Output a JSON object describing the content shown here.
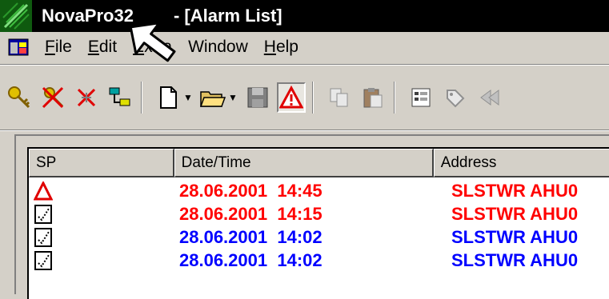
{
  "window": {
    "app_name": "NovaPro32",
    "doc_title": "- [Alarm List]",
    "app_icon": "novapro-leaf-icon"
  },
  "menu": {
    "icon": "mdi-child-window-icon",
    "items": [
      {
        "first": "F",
        "rest": "ile"
      },
      {
        "first": "E",
        "rest": "dit"
      },
      {
        "first": "E",
        "rest": "xtra"
      },
      {
        "first": "",
        "rest": "Window"
      },
      {
        "first": "H",
        "rest": "elp"
      }
    ]
  },
  "toolbar": {
    "buttons": [
      "key-icon",
      "key-cross-icon",
      "disconnect-icon",
      "network-icon",
      "new-document-icon",
      "open-folder-icon",
      "save-disk-icon",
      "alarm-warning-icon",
      "copy-icon",
      "paste-icon",
      "properties-icon",
      "tag-icon",
      "back-icon"
    ],
    "pressed": "alarm-warning-icon"
  },
  "alarm_list": {
    "columns": [
      "SP",
      "Date/Time",
      "Address"
    ],
    "rows": [
      {
        "sp_icon": "alarm-triangle-icon",
        "date": "28.06.2001",
        "time": "14:45",
        "address": "SLSTWR AHU0",
        "color": "#ff0000"
      },
      {
        "sp_icon": "acknowledged-check-icon",
        "date": "28.06.2001",
        "time": "14:15",
        "address": "SLSTWR AHU0",
        "color": "#ff0000"
      },
      {
        "sp_icon": "acknowledged-check-icon",
        "date": "28.06.2001",
        "time": "14:02",
        "address": "SLSTWR AHU0",
        "color": "#0000ff"
      },
      {
        "sp_icon": "acknowledged-check-icon",
        "date": "28.06.2001",
        "time": "14:02",
        "address": "SLSTWR AHU0",
        "color": "#0000ff"
      }
    ]
  },
  "colors": {
    "titlebar": "#000000",
    "face": "#d4d0c8",
    "alarm_active": "#ff0000",
    "alarm_cleared": "#0000ff"
  }
}
